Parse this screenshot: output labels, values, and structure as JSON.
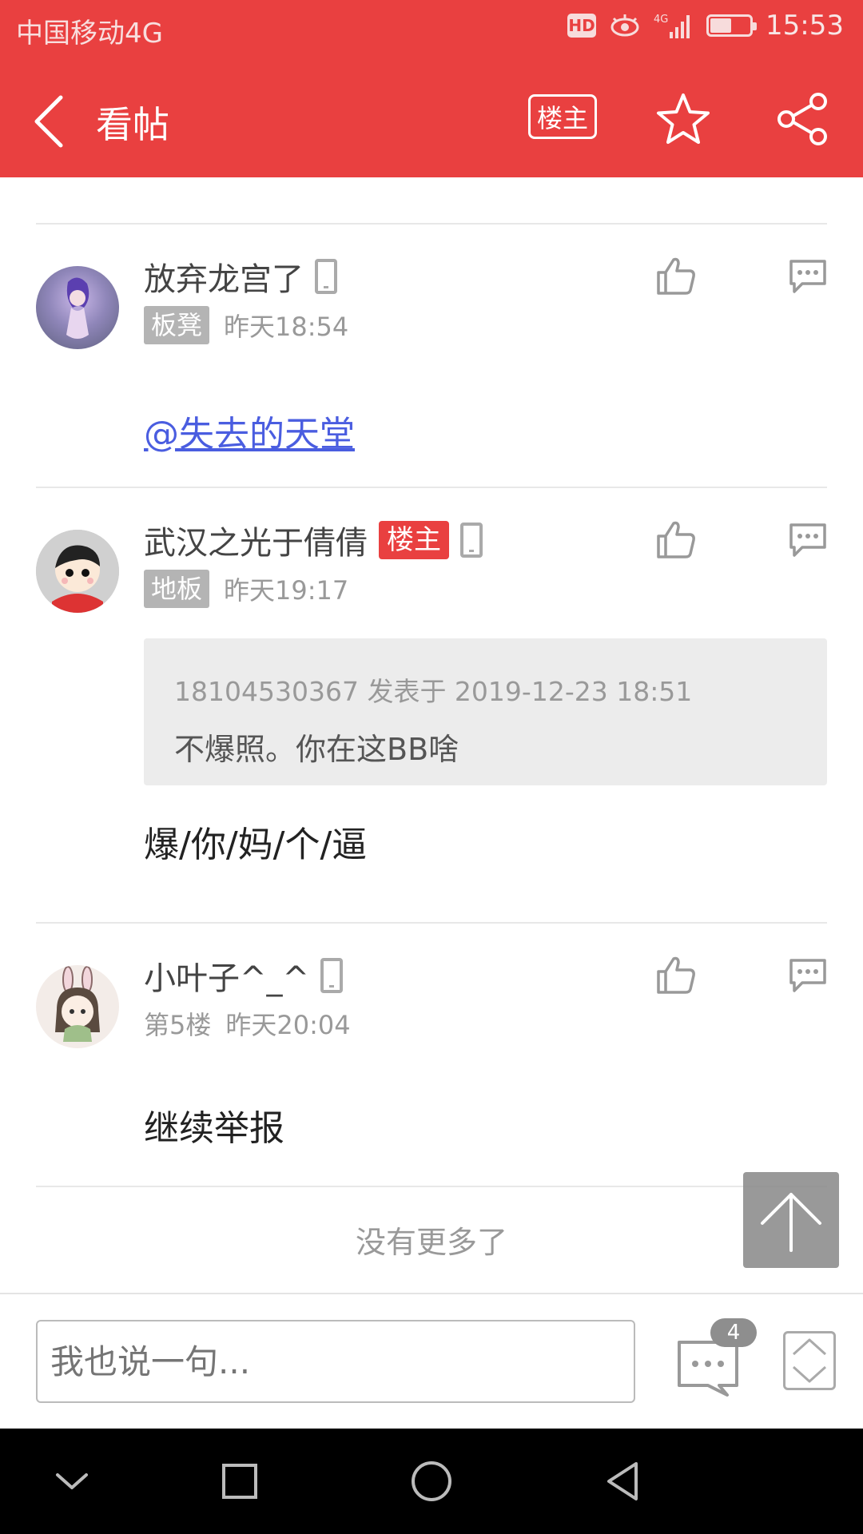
{
  "status_bar": {
    "carrier": "中国移动4G",
    "hd": "HD",
    "network": "4G",
    "battery_level": 0.55,
    "time": "15:53"
  },
  "header": {
    "title": "看帖",
    "owner_button": "楼主",
    "icons": [
      "back-icon",
      "star-icon",
      "share-icon"
    ]
  },
  "posts": [
    {
      "username": "放弃龙宫了",
      "floor": "板凳",
      "time": "昨天18:54",
      "mention": "@失去的天堂",
      "icons": [
        "phone-icon",
        "like-icon",
        "reply-icon"
      ]
    },
    {
      "username": "武汉之光于倩倩",
      "owner_tag": "楼主",
      "floor": "地板",
      "time": "昨天19:17",
      "quote": {
        "meta": "18104530367 发表于 2019-12-23 18:51",
        "text": "不爆照。你在这BB啥"
      },
      "body": "爆/你/妈/个/逼"
    },
    {
      "username": "小叶子^_^",
      "floor": "第5楼",
      "time": "昨天20:04",
      "body": "继续举报"
    }
  ],
  "footer": {
    "no_more": "没有更多了"
  },
  "bottom_bar": {
    "placeholder": "我也说一句...",
    "comment_count": "4"
  },
  "colors": {
    "brand_red": "#e94040",
    "mention_blue": "#4a5de0",
    "tag_gray": "#b4b4b4"
  }
}
